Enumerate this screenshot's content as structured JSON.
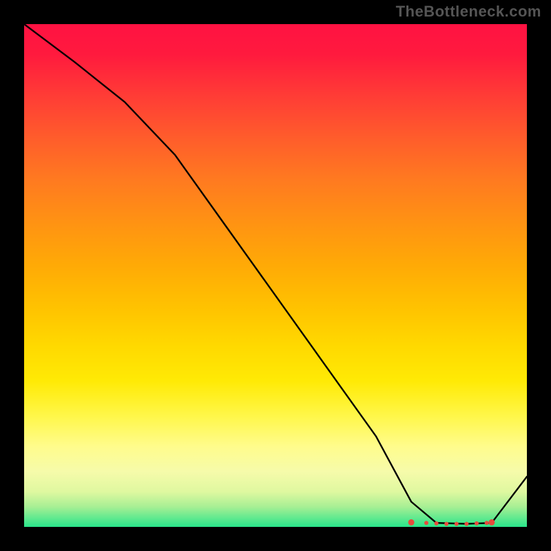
{
  "watermark": "TheBottleneck.com",
  "chart_data": {
    "type": "line",
    "title": "",
    "xlabel": "",
    "ylabel": "",
    "xlim": [
      0,
      100
    ],
    "ylim": [
      0,
      100
    ],
    "series": [
      {
        "name": "curve",
        "x": [
          0,
          10,
          20,
          30,
          40,
          50,
          60,
          70,
          77,
          82,
          88,
          93,
          100
        ],
        "y": [
          100,
          92.5,
          84.5,
          74,
          60,
          46,
          32,
          18,
          5,
          0.8,
          0.6,
          0.8,
          10
        ]
      }
    ],
    "markers": {
      "name": "flat-zone",
      "x": [
        77,
        80,
        82,
        84,
        86,
        88,
        90,
        92,
        93
      ],
      "y": [
        0.9,
        0.8,
        0.7,
        0.6,
        0.6,
        0.6,
        0.7,
        0.8,
        0.9
      ],
      "color": "#e74c3c",
      "shape": "circle"
    },
    "gradient_band": {
      "top_color": "#ff1242",
      "bottom_color": "#29e58b"
    }
  }
}
